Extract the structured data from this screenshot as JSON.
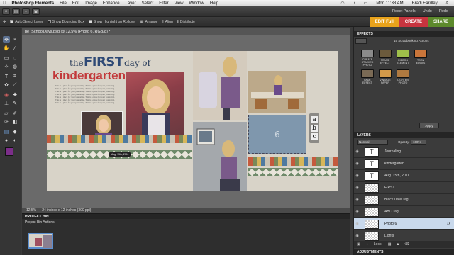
{
  "menubar": {
    "apple": "",
    "app_name": "Photoshop Elements",
    "menus": [
      "File",
      "Edit",
      "Image",
      "Enhance",
      "Layer",
      "Select",
      "Filter",
      "View",
      "Window",
      "Help"
    ],
    "clock": "Mon 11:38 AM",
    "user": "Bradi Eardley"
  },
  "appbar": {
    "reset_panels": "Reset Panels",
    "undo": "Undo",
    "redo": "Redo"
  },
  "options": {
    "auto_select": "Auto Select Layer",
    "bounding_box": "Show Bounding Box",
    "highlight": "Show Highlight on Rollover",
    "arrange": "Arrange",
    "align": "Align",
    "distribute": "Distribute"
  },
  "modes": {
    "edit": "EDIT Full",
    "create": "CREATE",
    "share": "SHARE",
    "colors": {
      "edit": "#e8a21b",
      "create": "#c8343f",
      "share": "#5d8a2c"
    }
  },
  "document": {
    "tab_title": "be_SchoolDays.psd @ 12.5% (Photo 6, RGB/8) *",
    "zoom": "12.5%",
    "doc_size": "24 inches x 12 inches (300 ppi)"
  },
  "layout": {
    "title_the": "the",
    "title_first": "FIRST",
    "title_day_of": "day of",
    "title_kindergarten": "kindergarten",
    "journal_line": "This is a place for your journaling. This is a place for your journaling.",
    "date_tag": "Aug. 15th, 2011",
    "photo6_label": "6",
    "tag_a": "a",
    "tag_b": "b",
    "tag_c": "c"
  },
  "project_bin": {
    "header": "PROJECT BIN",
    "actions": "Project Bin Actions"
  },
  "effects": {
    "header": "EFFECTS",
    "dropdown": "15 Scrapbooking Actions",
    "apply": "Apply",
    "items": [
      {
        "label": "CREATE STACKED PHOTO",
        "color": "#8a8a8a"
      },
      {
        "label": "FRAME EFFECT",
        "color": "#6b5a3c"
      },
      {
        "label": "RIBBON ELEMENT",
        "color": "#9fbf4a"
      },
      {
        "label": "TORN EDGES",
        "color": "#c9753a"
      },
      {
        "label": "FADE EFFECT",
        "color": "#7a6a55"
      },
      {
        "label": "VINTAGE PAPER",
        "color": "#d39a4a"
      },
      {
        "label": "LIGHTEN PHOTO",
        "color": "#b07a40"
      }
    ]
  },
  "layers": {
    "header": "LAYERS",
    "blend_mode": "Normal",
    "opacity_label": "Opacity:",
    "opacity_value": "100%",
    "lock_label": "Lock:",
    "items": [
      {
        "name": "Journaling",
        "kind": "T",
        "selected": false
      },
      {
        "name": "kindergarten",
        "kind": "T",
        "selected": false
      },
      {
        "name": "Aug. 15th, 2011",
        "kind": "T",
        "selected": false
      },
      {
        "name": "FIRST",
        "kind": "img",
        "selected": false
      },
      {
        "name": "Black Date Tag",
        "kind": "img",
        "selected": false
      },
      {
        "name": "ABC Tag",
        "kind": "img",
        "selected": false
      },
      {
        "name": "Photo 6",
        "kind": "img",
        "selected": true
      },
      {
        "name": "Lights",
        "kind": "img",
        "selected": false
      }
    ]
  },
  "adjustments": {
    "header": "ADJUSTMENTS"
  }
}
